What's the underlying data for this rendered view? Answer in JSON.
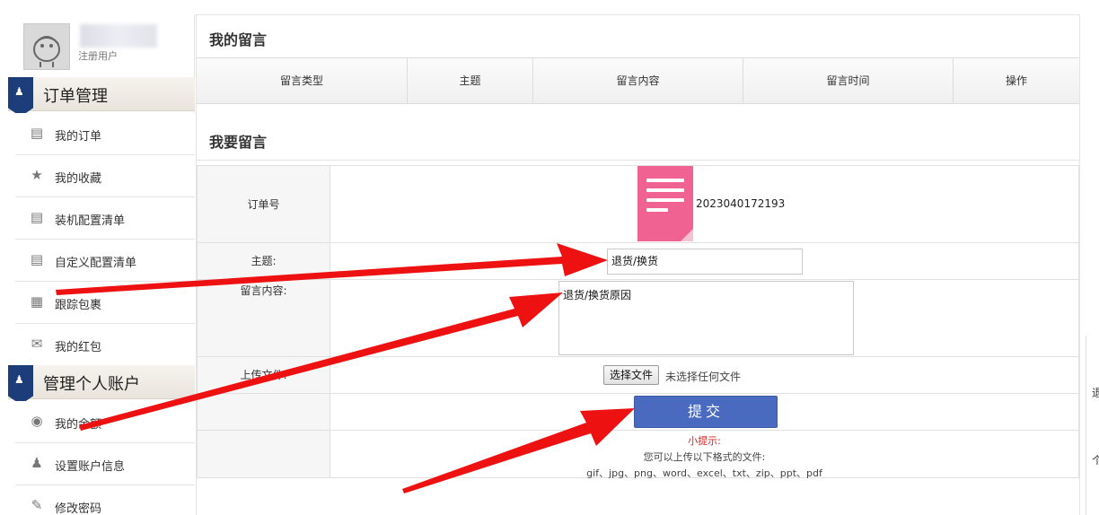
{
  "user": {
    "role": "注册用户"
  },
  "sidebar": {
    "section1": "订单管理",
    "section2": "管理个人账户",
    "items": [
      {
        "label": "我的订单",
        "icon": "list-icon"
      },
      {
        "label": "我的收藏",
        "icon": "star-icon"
      },
      {
        "label": "装机配置清单",
        "icon": "list-icon"
      },
      {
        "label": "自定义配置清单",
        "icon": "list-icon"
      },
      {
        "label": "跟踪包裹",
        "icon": "grid-icon"
      },
      {
        "label": "我的红包",
        "icon": "envelope-icon"
      },
      {
        "label": "我的余额",
        "icon": "money-bag-icon"
      },
      {
        "label": "设置账户信息",
        "icon": "person-icon"
      },
      {
        "label": "修改密码",
        "icon": "pencil-icon"
      }
    ]
  },
  "messages": {
    "title": "我的留言",
    "columns": [
      "留言类型",
      "主题",
      "留言内容",
      "留言时间",
      "操作"
    ]
  },
  "form": {
    "title": "我要留言",
    "order_label": "订单号",
    "order_no": "2023040172193",
    "subject_label": "主题:",
    "subject_value": "退货/换货",
    "content_label": "留言内容:",
    "content_value": "退货/换货原因",
    "upload_label": "上传文件:",
    "file_button": "选择文件",
    "file_status": "未选择任何文件",
    "submit": "提交",
    "tip_title": "小提示:",
    "tip_line1": "您可以上传以下格式的文件:",
    "tip_line2": "gif、jpg、png、word、excel、txt、zip、ppt、pdf"
  },
  "right_edge": {
    "frag1": "退",
    "frag2": "个"
  },
  "colors": {
    "accent": "#1d3c7a",
    "submit": "#4a6ac0",
    "doc_icon": "#f06292",
    "tip_title": "#e02020",
    "arrow": "#ee1111"
  }
}
